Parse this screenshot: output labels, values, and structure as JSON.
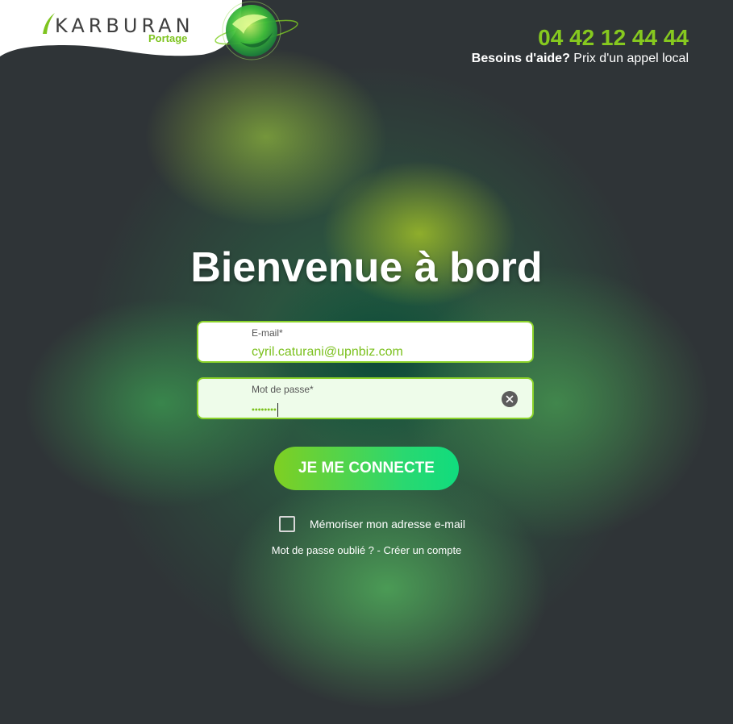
{
  "brand": {
    "name": "KARBURAN",
    "sub": "Portage"
  },
  "contact": {
    "phone": "04 42 12 44 44",
    "help_bold": "Besoins d'aide?",
    "help_text": " Prix d'un appel local"
  },
  "main": {
    "title": "Bienvenue à bord"
  },
  "form": {
    "email_label": "E-mail*",
    "email_value": "cyril.caturani@upnbiz.com",
    "password_label": "Mot de passe*",
    "password_value": "••••••••",
    "submit_label": "JE ME CONNECTE",
    "remember_label": "Mémoriser mon adresse e-mail",
    "forgot_label": "Mot de passe oublié ?",
    "separator": " - ",
    "create_label": "Créer un compte"
  },
  "icons": {
    "clear": "close-icon",
    "logo_mark": "k-swoosh-icon",
    "globe": "globe-icon"
  },
  "colors": {
    "accent": "#86c91f",
    "button_start": "#7fcf22",
    "button_end": "#10dc7e"
  }
}
